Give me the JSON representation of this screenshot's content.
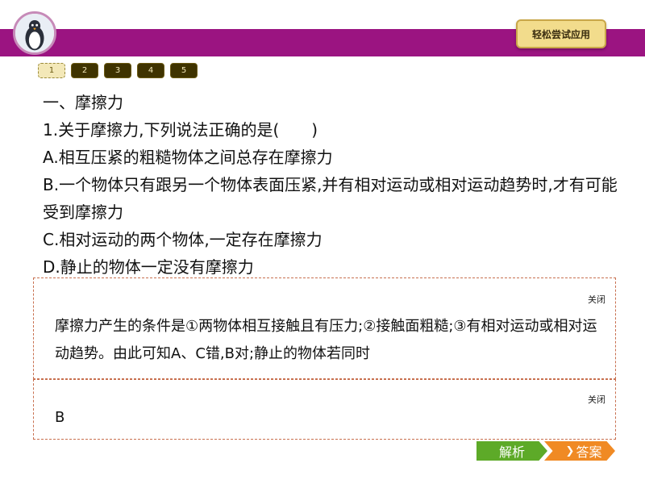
{
  "header": {
    "mode_badge": "轻松尝试应用"
  },
  "pager": {
    "pages": [
      "1",
      "2",
      "3",
      "4",
      "5"
    ],
    "active_index": 0
  },
  "question": {
    "section_title": "一、摩擦力",
    "stem": "1.关于摩擦力,下列说法正确的是(　　)",
    "options": [
      "A.相互压紧的粗糙物体之间总存在摩擦力",
      "B.一个物体只有跟另一个物体表面压紧,并有相对运动或相对运动趋势时,才有可能受到摩擦力",
      "C.相对运动的两个物体,一定存在摩擦力",
      "D.静止的物体一定没有摩擦力"
    ]
  },
  "analysis_panel": {
    "close_label": "关闭",
    "text": "摩擦力产生的条件是①两物体相互接触且有压力;②接触面粗糙;③有相对运动或相对运动趋势。由此可知A、C错,B对;静止的物体若同时"
  },
  "answer_panel": {
    "close_label": "关闭",
    "text": "B"
  },
  "tabs": {
    "analysis_label": "解析",
    "answer_label": "答案",
    "chevron_icon": "chevron-right-icon"
  },
  "colors": {
    "header_band": "#9b1481",
    "badge_bg": "#f2dc8c",
    "analysis_tab": "#5daa28",
    "answer_tab": "#f08a24",
    "panel_border": "#c87050"
  }
}
